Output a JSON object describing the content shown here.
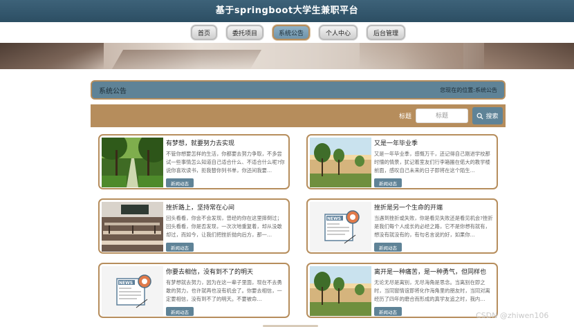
{
  "site": {
    "title": "基于springboot大学生兼职平台"
  },
  "nav": {
    "items": [
      {
        "label": "首页",
        "active": false
      },
      {
        "label": "委托项目",
        "active": false
      },
      {
        "label": "系统公告",
        "active": true
      },
      {
        "label": "个人中心",
        "active": false
      },
      {
        "label": "后台管理",
        "active": false
      }
    ]
  },
  "breadcrumb": {
    "title": "系统公告",
    "location_label": "您现在的位置:",
    "location_value": "系统公告"
  },
  "search": {
    "label": "标题",
    "placeholder": "标题",
    "button_label": "搜索"
  },
  "icons": {
    "search": "search-icon"
  },
  "colors": {
    "accent": "#5f8397",
    "border": "#b68d5c",
    "header": "#2c4e63"
  },
  "cards": [
    {
      "title": "有梦想，就要努力去实现",
      "desc": "不管你想要怎样的生活，你都要去努力争取，不多尝试一些事情怎么知道自己适合什么、不适合什么呢?你说你喜欢读书，拒我替你列书单，你还间我要…",
      "tag": "新闻动态",
      "image": "forest-path"
    },
    {
      "title": "又是一年毕业季",
      "desc": "又是一年毕业季，感慨万千，还记得自己刚进学校那时懵的情景，犹记着室友们行李箱搬在偌大的教学楼前面，感叹自己未来的日子即将在这个陌生…",
      "tag": "新闻动态",
      "image": "campus-building"
    },
    {
      "title": "挫折路上，坚持常在心间",
      "desc": "回头看看，你会不会发现，曾经的你在这里摔倒过；回头看看，你是否发现，一次次地重复着，却从没敢却过，而如今，让我们把挫折抛向后方，那一…",
      "tag": "新闻动态",
      "image": "classroom"
    },
    {
      "title": "挫折是另一个生命的开端",
      "desc": "当遇到挫折或失败，你是看见失败还是看见机会?挫折是我们每个人成长的必经之路，它不是你想有就有，想没有就没有的，有句名言说的好，如果你…",
      "tag": "新闻动态",
      "image": "news-icon"
    },
    {
      "title": "你要去相信，没有到不了的明天",
      "desc": "有梦想就去努力，因为在这一辈子里面，现在不去勇敢的努力，也许就再也没有机会了。你要去相信，一定要相信，没有到不了的明天。不要被命…",
      "tag": "新闻动态",
      "image": "news-icon"
    },
    {
      "title": "离开是一种痛苦，是一种勇气，但同样也",
      "desc": "无论无尽是离别，无尽海角是思念。当离别在即之时，当同窗情谊即将化作海角里的朋友时，当同对离经历了四年的磨合而形成的真学友追之时，我内…",
      "tag": "新闻动态",
      "image": "campus-building"
    }
  ],
  "watermark": "CSDN @zhiwen106"
}
